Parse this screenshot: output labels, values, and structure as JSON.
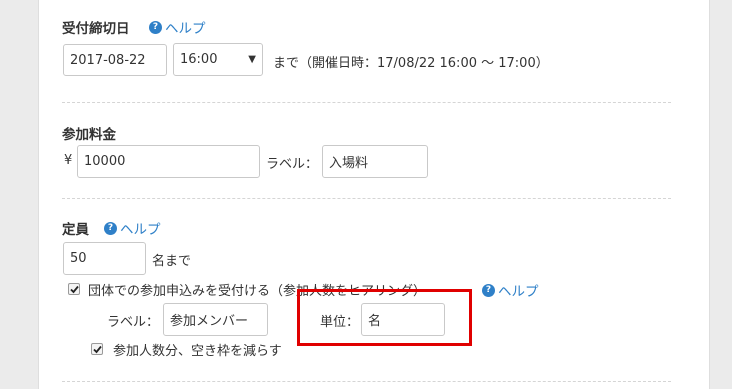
{
  "deadline": {
    "title": "受付締切日",
    "help": "ヘルプ",
    "date_value": "2017-08-22",
    "time_value": "16:00",
    "note": "まで（開催日時：17/08/22 16:00 〜 17:00）"
  },
  "fee": {
    "title": "参加料金",
    "currency": "¥",
    "amount_value": "10000",
    "label_caption": "ラベル：",
    "label_value": "入場料"
  },
  "capacity": {
    "title": "定員",
    "help": "ヘルプ",
    "count_value": "50",
    "count_suffix": "名まで",
    "group_checkbox_label": "団体での参加申込みを受付ける（参加人数をヒアリング）",
    "group_help": "ヘルプ",
    "group_label_caption": "ラベル：",
    "group_label_value": "参加メンバー",
    "unit_caption": "単位：",
    "unit_value": "名",
    "reduce_checkbox_label": "参加人数分、空き枠を減らす"
  },
  "colors": {
    "link": "#2f80c8",
    "highlight": "#e00000"
  }
}
